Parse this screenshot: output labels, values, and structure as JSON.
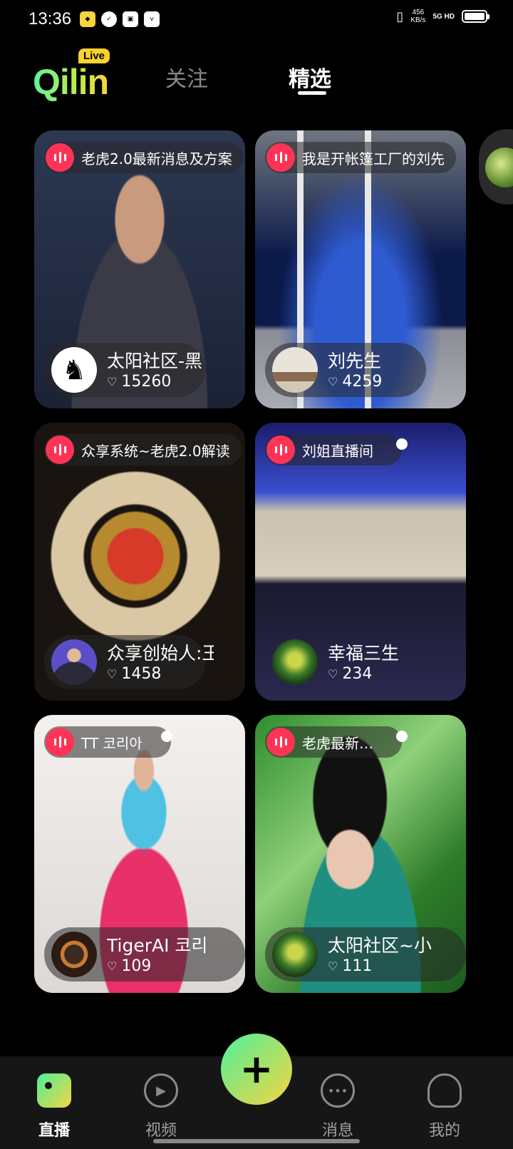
{
  "status_bar": {
    "time": "13:36",
    "net_speed_value": "456",
    "net_speed_unit": "KB/s",
    "network": "5G HD",
    "battery_level": 0.9
  },
  "header": {
    "logo_text": "Qilin",
    "logo_badge": "Live",
    "tabs": [
      {
        "label": "关注",
        "active": false
      },
      {
        "label": "精选",
        "active": true
      }
    ]
  },
  "cards": [
    {
      "title": "老虎2.0最新消息及方案",
      "host": "太阳社区-黑",
      "likes": "15260"
    },
    {
      "title": "我是开帐篷工厂的刘先",
      "host": "刘先生",
      "likes": "4259"
    },
    {
      "title": "众享系统~老虎2.0解读",
      "host": "众享创始人:王",
      "likes": "1458"
    },
    {
      "title": "刘姐直播间",
      "host": "幸福三生",
      "likes": "234"
    },
    {
      "title": "TT 코리아",
      "host": "TigerAI 코리",
      "likes": "109"
    },
    {
      "title": "老虎最新…",
      "host": "太阳社区~小",
      "likes": "111"
    }
  ],
  "bottom_nav": {
    "items": [
      {
        "label": "直播",
        "icon": "live-icon",
        "active": true
      },
      {
        "label": "视频",
        "icon": "play-icon",
        "active": false
      },
      {
        "label": "消息",
        "icon": "message-icon",
        "active": false
      },
      {
        "label": "我的",
        "icon": "profile-icon",
        "active": false
      }
    ],
    "fab_icon": "plus-icon"
  },
  "colors": {
    "accent_green": "#4ef09c",
    "accent_yellow": "#f6d43f",
    "live_red": "#ff3355"
  }
}
